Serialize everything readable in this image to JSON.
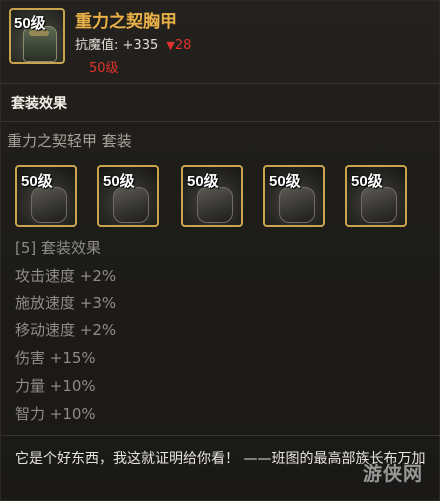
{
  "item": {
    "level_badge": "50级",
    "name": "重力之契胸甲",
    "stat_label": "抗魔值:",
    "stat_value": "+335",
    "stat_change_arrow": "▼",
    "stat_change": "28",
    "required_level": "50级"
  },
  "set": {
    "section_title": "套装效果",
    "set_name": "重力之契轻甲 套装",
    "pieces": [
      {
        "level_badge": "50级",
        "icon": "helmet-icon"
      },
      {
        "level_badge": "50级",
        "icon": "chest-armor-icon"
      },
      {
        "level_badge": "50级",
        "icon": "gauntlet-icon"
      },
      {
        "level_badge": "50级",
        "icon": "leg-armor-icon"
      },
      {
        "level_badge": "50级",
        "icon": "boots-icon"
      }
    ],
    "effect_header": "[5] 套装效果",
    "bonuses": [
      "攻击速度 +2%",
      "施放速度 +3%",
      "移动速度 +2%",
      "伤害 +15%",
      "力量 +10%",
      "智力 +10%"
    ]
  },
  "flavor_text": "它是个好东西，我这就证明给你看！ ——班图的最高部族长布万加",
  "watermark": "游侠网",
  "colors": {
    "name": "#e9b148",
    "frame": "#c9a44e",
    "negative": "#e0322b"
  }
}
